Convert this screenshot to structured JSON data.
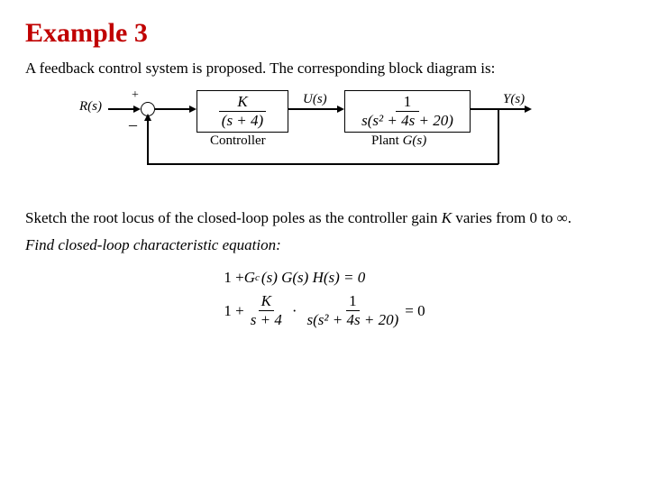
{
  "title": "Example 3",
  "intro": "A feedback control system is proposed.  The corresponding block diagram is:",
  "signals": {
    "R": "R(s)",
    "U": "U(s)",
    "Y": "Y(s)"
  },
  "sum": {
    "plus": "+",
    "minus": "–"
  },
  "controller": {
    "num": "K",
    "den": "(s + 4)",
    "label": "Controller"
  },
  "plant": {
    "num": "1",
    "den": "s(s² + 4s + 20)",
    "label_pre": "Plant  ",
    "label_G": "G(s)"
  },
  "task_a": "Sketch the root locus of the closed-loop poles as the controller gain ",
  "task_K": "K",
  "task_b": " varies from 0 to ∞.",
  "step": "Find closed-loop characteristic equation:",
  "eq1": {
    "lead": "1 + ",
    "Gc": "G",
    "c": "c",
    "mid": "(s) G(s) H(s) = 0"
  },
  "eq2": {
    "lead": "1 + ",
    "f1n": "K",
    "f1d": "s + 4",
    "f2n": "1",
    "f2d": "s(s² + 4s + 20)",
    "tail": " = 0"
  }
}
